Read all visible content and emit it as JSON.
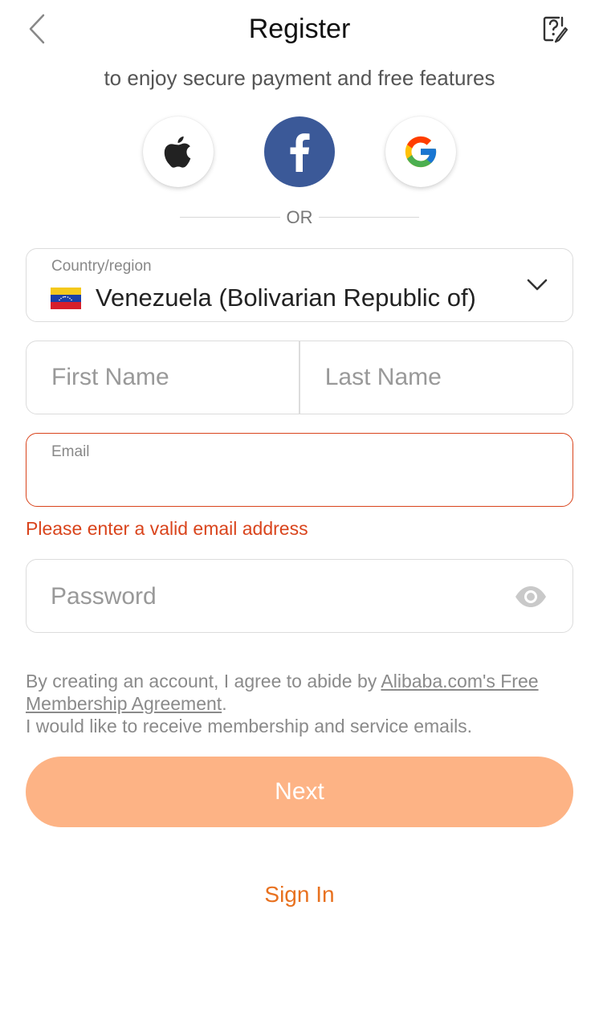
{
  "header": {
    "title": "Register",
    "back_icon": "chevron-left-icon",
    "help_icon": "help-edit-icon"
  },
  "subtitle": "to enjoy secure payment and free features",
  "social": {
    "apple_icon": "apple-icon",
    "facebook_icon": "facebook-icon",
    "google_icon": "google-icon",
    "facebook_color": "#3b5998"
  },
  "divider_text": "OR",
  "country": {
    "label": "Country/region",
    "value": "Venezuela (Bolivarian Republic of)",
    "flag_icon": "venezuela-flag-icon"
  },
  "name": {
    "first_placeholder": "First Name",
    "last_placeholder": "Last Name"
  },
  "email": {
    "label": "Email",
    "value": "",
    "error": "Please enter a valid email address",
    "error_color": "#d9441c"
  },
  "password": {
    "placeholder": "Password",
    "toggle_icon": "eye-icon"
  },
  "terms": {
    "prefix": "By creating an account, I agree to abide by ",
    "link": "Alibaba.com's Free Membership Agreement",
    "suffix": ".",
    "emails": "I would like to receive membership and service emails."
  },
  "next_button": {
    "label": "Next",
    "color": "#fdb385"
  },
  "signin_link": {
    "label": "Sign In",
    "color": "#e8711f"
  }
}
